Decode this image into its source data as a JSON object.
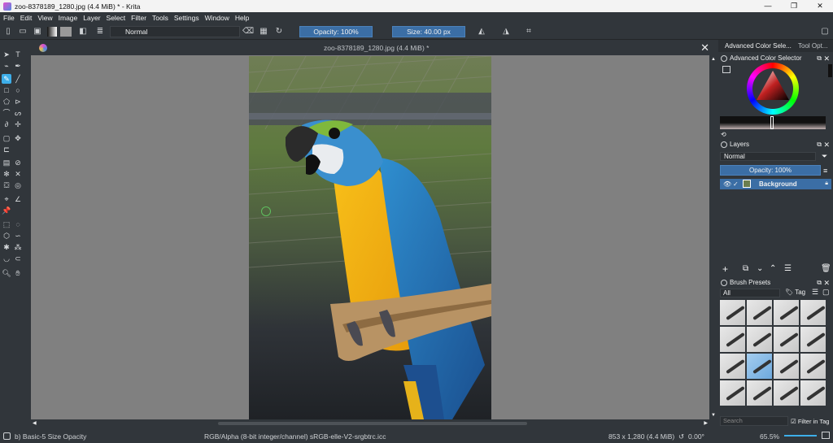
{
  "window": {
    "title": "zoo-8378189_1280.jpg (4.4 MiB) * - Krita",
    "controls": [
      "—",
      "❐",
      "✕"
    ]
  },
  "menu": [
    "File",
    "Edit",
    "View",
    "Image",
    "Layer",
    "Select",
    "Filter",
    "Tools",
    "Settings",
    "Window",
    "Help"
  ],
  "toolbar": {
    "blend_mode": "Normal",
    "opacity": "Opacity: 100%",
    "size": "Size: 40.00 px"
  },
  "document": {
    "tab_title": "zoo-8378189_1280.jpg (4.4 MiB) *"
  },
  "dock": {
    "tabs": [
      "Advanced Color Sele...",
      "Tool Opt..."
    ],
    "color_selector_title": "Advanced Color Selector",
    "layers_title": "Layers",
    "layer_blend": "Normal",
    "layer_opacity": "Opacity:  100%",
    "layers": [
      {
        "name": "Background",
        "visible": true
      }
    ],
    "brush_presets_title": "Brush Presets",
    "brush_filter": "All",
    "tag_label": "Tag",
    "search_placeholder": "Search",
    "filter_in_tag": "Filter in Tag"
  },
  "status": {
    "brush": "b) Basic-5 Size Opacity",
    "color_space": "RGB/Alpha (8-bit integer/channel)  sRGB-elle-V2-srgbtrc.icc",
    "dimensions": "853 x 1,280 (4.4 MiB)",
    "rotation": "0.00°",
    "zoom": "65.5%"
  },
  "colors": {
    "accent": "#3daee9",
    "selection": "#3b6ea5",
    "background": "#31363b",
    "canvas": "#808080"
  }
}
